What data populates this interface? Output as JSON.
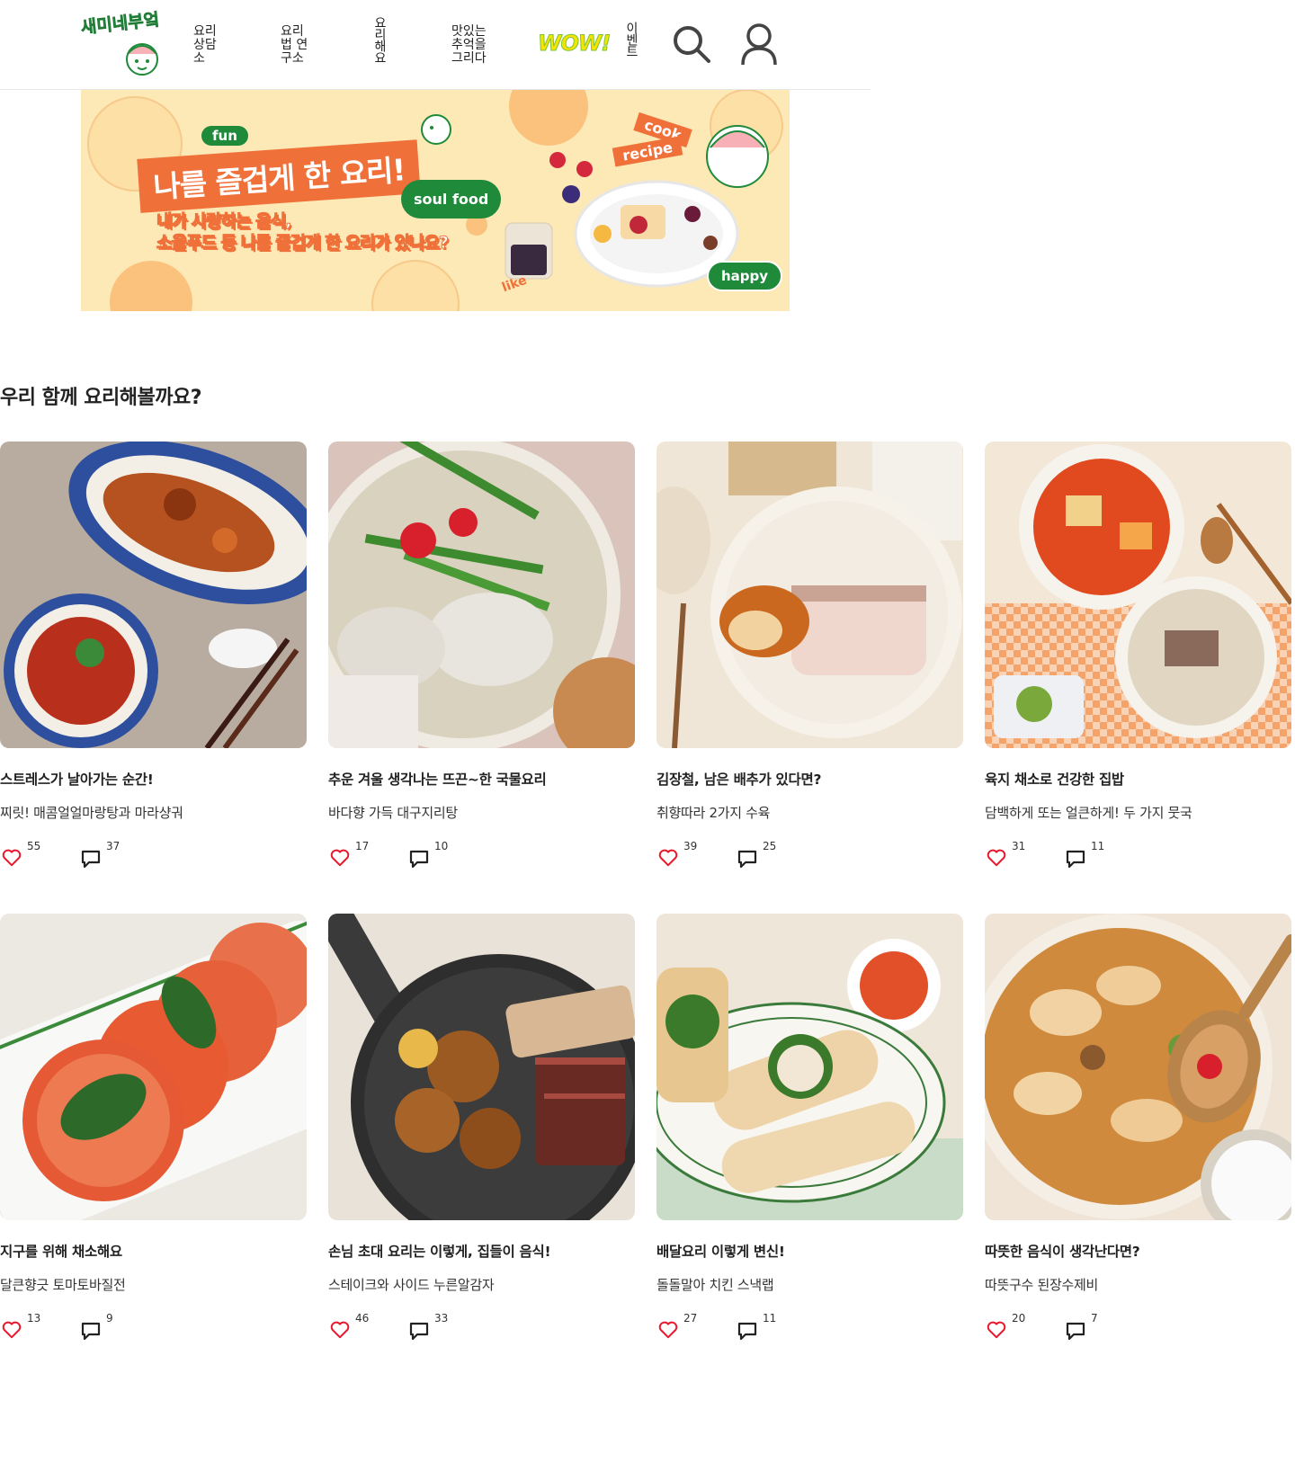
{
  "header": {
    "logo_text": "새미네부엌",
    "nav": {
      "consult": "요리\n상담\n소",
      "lab": "요리\n법 연\n구소",
      "cook": "요리해요",
      "memory": "맛있는\n추억을\n그리다",
      "wow": "WOW!",
      "event": "이벤트"
    }
  },
  "banner": {
    "fun": "fun",
    "title": "나를 즐겁게 한 요리!",
    "soul": "soul food",
    "subtitle": "내가 사랑하는 음식,\n소울푸드 등 나를 즐겁게 한 요리가 있나요?",
    "cook": "cook",
    "recipe": "recipe",
    "happy": "happy",
    "like": "like"
  },
  "section": {
    "title": "우리 함께 요리해볼까요?"
  },
  "cards": [
    {
      "title": "스트레스가 날아가는 순간!",
      "desc": "찌릿! 매콤얼얼마랑탕과 마라샹궈",
      "likes": "55",
      "comments": "37"
    },
    {
      "title": "추운 겨울 생각나는 뜨끈~한 국물요리",
      "desc": "바다향 가득 대구지리탕",
      "likes": "17",
      "comments": "10"
    },
    {
      "title": "김장철, 남은 배추가 있다면?",
      "desc": "취향따라 2가지 수육",
      "likes": "39",
      "comments": "25"
    },
    {
      "title": "육지 채소로 건강한 집밥",
      "desc": "담백하게 또는 얼큰하게! 두 가지 뭇국",
      "likes": "31",
      "comments": "11"
    },
    {
      "title": "지구를 위해 채소해요",
      "desc": "달큰향긋 토마토바질전",
      "likes": "13",
      "comments": "9"
    },
    {
      "title": "손님 초대 요리는 이렇게, 집들이 음식!",
      "desc": "스테이크와 사이드 누른알감자",
      "likes": "46",
      "comments": "33"
    },
    {
      "title": "배달요리 이렇게 변신!",
      "desc": "돌돌말아 치킨 스낵랩",
      "likes": "27",
      "comments": "11"
    },
    {
      "title": "따뜻한 음식이 생각난다면?",
      "desc": "따뜻구수 된장수제비",
      "likes": "20",
      "comments": "7"
    }
  ],
  "colors": {
    "accent_orange": "#f0703a",
    "brand_green": "#1f8a3a",
    "heart_red": "#e8192c",
    "banner_bg": "#fde9b6"
  }
}
